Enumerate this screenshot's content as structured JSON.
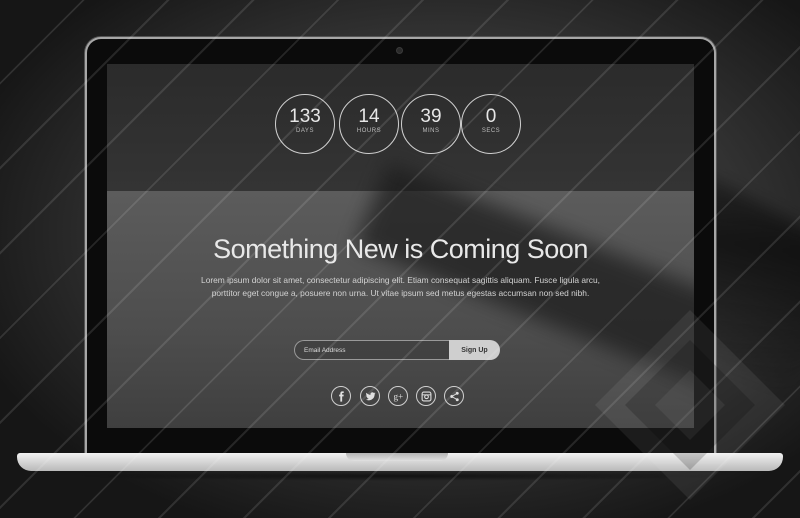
{
  "countdown": [
    {
      "value": "133",
      "unit": "DAYS"
    },
    {
      "value": "14",
      "unit": "HOURS"
    },
    {
      "value": "39",
      "unit": "MINS"
    },
    {
      "value": "0",
      "unit": "SECS"
    }
  ],
  "headline": "Something New is Coming Soon",
  "body": "Lorem ipsum dolor sit amet, consectetur adipiscing elit. Etiam consequat sagittis aliquam. Fusce ligula arcu, porttitor eget congue a, posuere non urna. Ut vitae ipsum sed metus egestas accumsan non sed nibh.",
  "signup": {
    "placeholder": "Email Address",
    "button_label": "Sign Up"
  },
  "social": [
    {
      "icon": "facebook-icon"
    },
    {
      "icon": "twitter-icon"
    },
    {
      "icon": "google-plus-icon"
    },
    {
      "icon": "instagram-icon"
    },
    {
      "icon": "share-icon"
    }
  ],
  "colors": {
    "accent": "#cfcfcf",
    "text": "#e8e8e8",
    "button_bg": "#cfcfcf"
  }
}
